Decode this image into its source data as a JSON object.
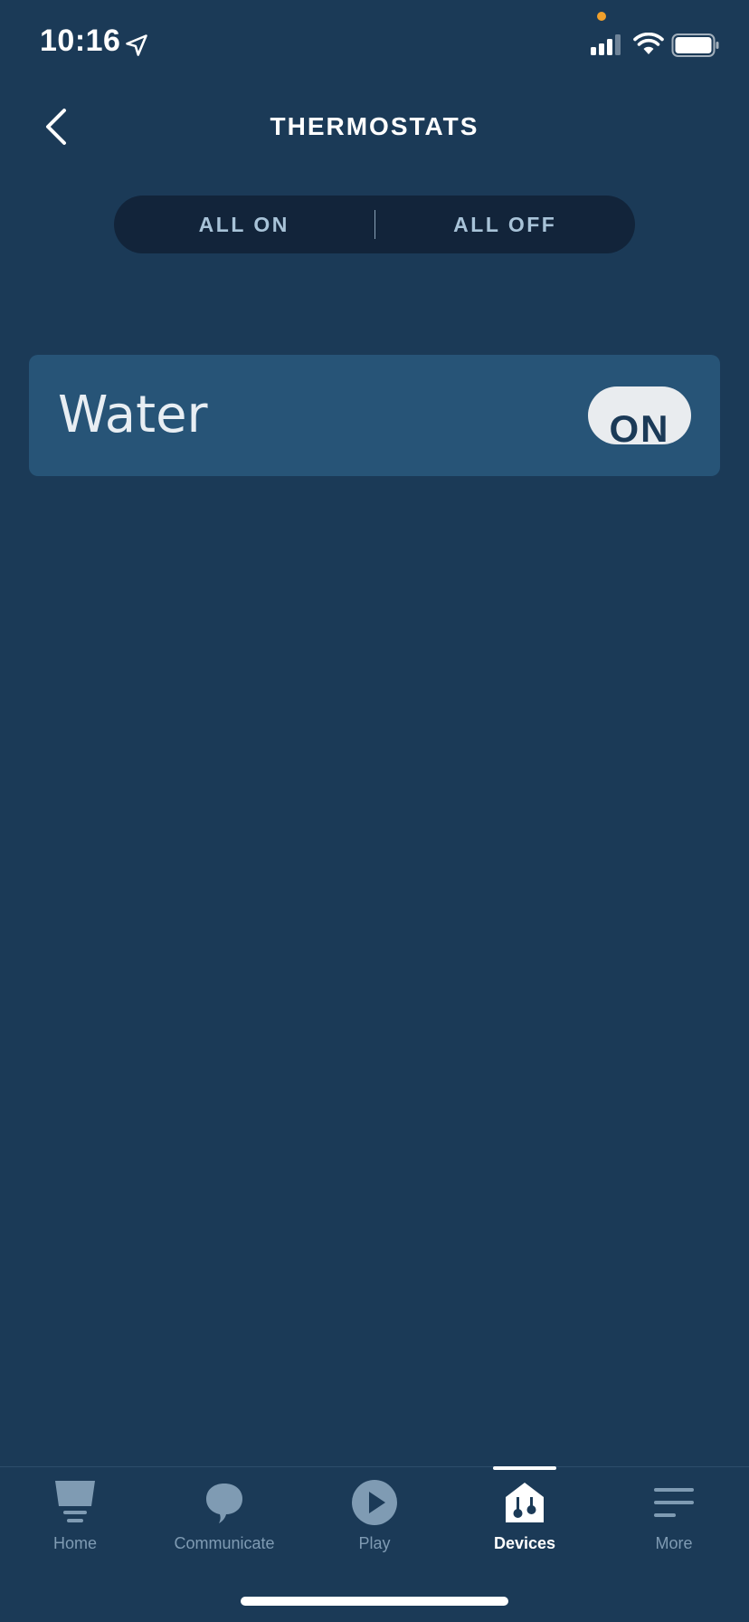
{
  "status_bar": {
    "time": "10:16",
    "privacy_dot_color": "#f0a02c"
  },
  "header": {
    "title": "THERMOSTATS",
    "back_icon": "chevron-left-icon"
  },
  "segment": {
    "all_on_label": "ALL ON",
    "all_off_label": "ALL OFF"
  },
  "devices": [
    {
      "name": "Water",
      "toggle_label": "ON"
    }
  ],
  "tab_bar": {
    "tabs": [
      {
        "label": "Home",
        "icon": "home-icon"
      },
      {
        "label": "Communicate",
        "icon": "chat-bubble-icon"
      },
      {
        "label": "Play",
        "icon": "play-icon"
      },
      {
        "label": "Devices",
        "icon": "devices-icon",
        "active": true
      },
      {
        "label": "More",
        "icon": "menu-icon"
      }
    ]
  },
  "colors": {
    "background": "#1b3a57",
    "card": "#275477",
    "segment_bg": "#12243a",
    "accent_text": "#a8c3d8",
    "inactive_tab": "#7f9bb3"
  }
}
